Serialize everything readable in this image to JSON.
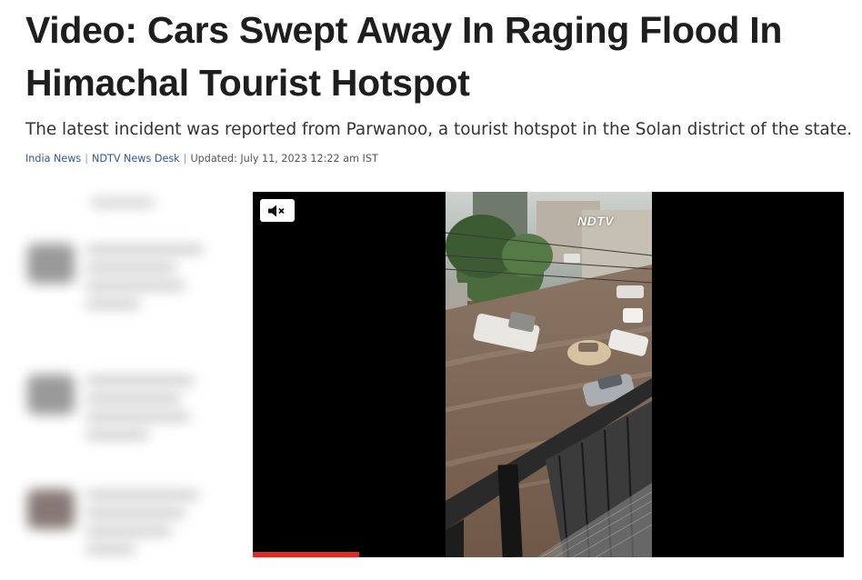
{
  "article": {
    "headline": "Video: Cars Swept Away In Raging Flood In Himachal Tourist Hotspot",
    "summary": "The latest incident was reported from Parwanoo, a tourist hotspot in the Solan district of the state.",
    "byline": {
      "category": "India News",
      "author": "NDTV News Desk",
      "updated": "Updated: July 11, 2023 12:22 am IST",
      "separator": "|"
    }
  },
  "video": {
    "watermark": "NDTV",
    "mute_icon": "speaker-muted-icon",
    "progress_fraction": 0.18,
    "colors": {
      "background": "#000000",
      "progress": "#e32727",
      "flood": "#7a6250"
    }
  },
  "sidebar": {
    "blurred": true,
    "item_count": 3
  }
}
